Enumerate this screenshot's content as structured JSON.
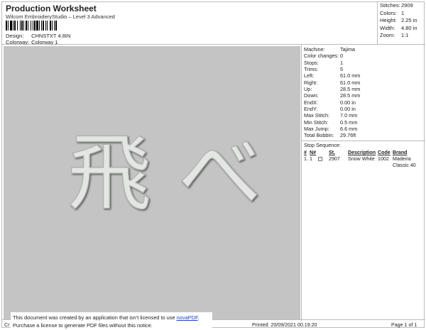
{
  "header": {
    "title": "Production Worksheet",
    "subtitle": "Wilcom EmbroideryStudio – Level 3 Advanced",
    "design_label": "Design:",
    "design_value": "CHNSTXT 4.8IN",
    "colorway_label": "Colorway:",
    "colorway_value": "Colorway 1"
  },
  "summary": [
    {
      "key": "Stitches:",
      "value": "2909"
    },
    {
      "key": "Colors:",
      "value": "1"
    },
    {
      "key": "Height:",
      "value": "2.25 in"
    },
    {
      "key": "Width:",
      "value": "4.80 in"
    },
    {
      "key": "Zoom:",
      "value": "1:1"
    }
  ],
  "machine_info": [
    {
      "key": "Machine:",
      "value": "Tajima"
    },
    {
      "key": "Color changes:",
      "value": "0"
    },
    {
      "key": "Stops:",
      "value": "1"
    },
    {
      "key": "Trims:",
      "value": "5"
    },
    {
      "key": "Left:",
      "value": "61.0 mm"
    },
    {
      "key": "Right:",
      "value": "61.0 mm"
    },
    {
      "key": "Up:",
      "value": "28.5 mm"
    },
    {
      "key": "Down:",
      "value": "28.5 mm"
    },
    {
      "key": "EndX:",
      "value": "0.00 in"
    },
    {
      "key": "EndY:",
      "value": "0.00 in"
    },
    {
      "key": "Max Stitch:",
      "value": "7.0 mm"
    },
    {
      "key": "Min Stitch:",
      "value": "0.5 mm"
    },
    {
      "key": "Max Jump:",
      "value": "6.6 mm"
    },
    {
      "key": "Total Bobbin:",
      "value": "29.76ft"
    }
  ],
  "stop_sequence": {
    "label": "Stop Sequence:",
    "columns": [
      "#",
      "N#",
      "St.",
      "Description",
      "Code",
      "Brand"
    ],
    "rows": [
      {
        "num": "1.",
        "n": "1",
        "st": "2907",
        "desc": "Snow White",
        "code": "1002",
        "brand": "Madeira Classic 40"
      }
    ]
  },
  "design_preview": {
    "text": "飛 べ",
    "background_color": "#c4c4c4",
    "thread_color": "#e4e6e4"
  },
  "notice": {
    "line1_pre": "This document was created by an application that isn't licensed to use ",
    "line1_link": "novaPDF",
    "line1_post": ".",
    "line2": "Purchase a license to generate PDF files without this notice."
  },
  "footer": {
    "left": "Cr",
    "printed": "Printed: 20/09/2021 00.19.20",
    "page": "Page 1 of 1"
  }
}
